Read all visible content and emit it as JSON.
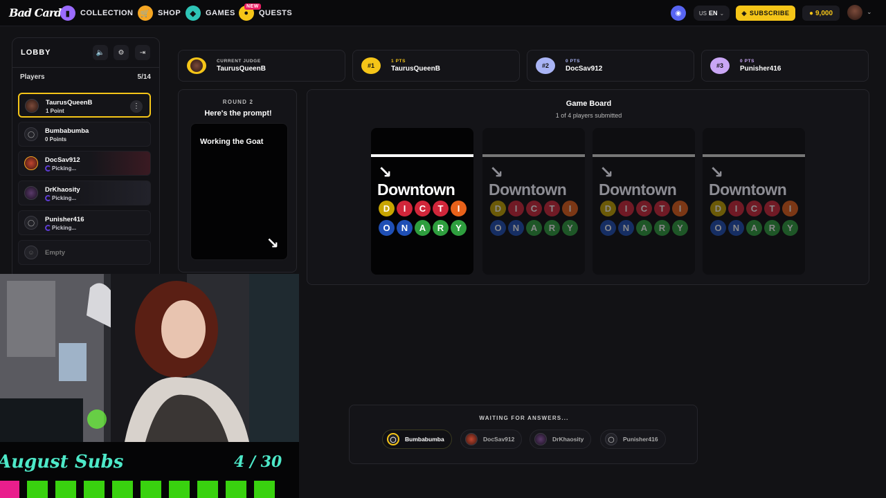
{
  "brand": {
    "logo": "Bad Cards"
  },
  "nav": {
    "items": [
      {
        "label": "COLLECTION",
        "icon": "card-icon",
        "color": "#9b6bff"
      },
      {
        "label": "SHOP",
        "icon": "cart-icon",
        "color": "#f5a623"
      },
      {
        "label": "GAMES",
        "icon": "gamepad-icon",
        "color": "#2ec4b6"
      },
      {
        "label": "QUESTS",
        "icon": "quest-icon",
        "color": "#f5c518",
        "badge": "NEW"
      }
    ],
    "lang_region": "US",
    "lang_code": "EN",
    "subscribe_label": "SUBSCRIBE",
    "coins": "9,000"
  },
  "lobby": {
    "title": "LOBBY",
    "players_label": "Players",
    "players_count": "5/14",
    "players": [
      {
        "name": "TaurusQueenB",
        "status": "1 Point",
        "active": true
      },
      {
        "name": "Bumbabumba",
        "status": "0 Points"
      },
      {
        "name": "DocSav912",
        "status": "Picking..."
      },
      {
        "name": "DrKhaosity",
        "status": "Picking..."
      },
      {
        "name": "Punisher416",
        "status": "Picking..."
      },
      {
        "name": "Empty",
        "status": ""
      }
    ]
  },
  "scoreboard": [
    {
      "label": "CURRENT JUDGE",
      "name": "TaurusQueenB",
      "badge": "",
      "color": "#f5c518"
    },
    {
      "label": "1 PTS",
      "name": "TaurusQueenB",
      "badge": "#1",
      "color": "#f5c518"
    },
    {
      "label": "0 PTS",
      "name": "DocSav912",
      "badge": "#2",
      "color": "#a9b4f5"
    },
    {
      "label": "0 PTS",
      "name": "Punisher416",
      "badge": "#3",
      "color": "#c9a6f5"
    }
  ],
  "prompt": {
    "round": "ROUND 2",
    "heading": "Here's the prompt!",
    "text": "Working the Goat"
  },
  "board": {
    "title": "Game Board",
    "subtitle": "1 of 4 players submitted",
    "card_word": "Downtown",
    "row1": [
      "D",
      "I",
      "C",
      "T",
      "I"
    ],
    "row2": [
      "O",
      "N",
      "A",
      "R",
      "Y"
    ],
    "row1_colors": [
      "#c8a500",
      "#d1263a",
      "#d1263a",
      "#d1263a",
      "#e8611a"
    ],
    "row2_colors": [
      "#1f4fb5",
      "#1f4fb5",
      "#2e9e3e",
      "#2e9e3e",
      "#2e9e3e"
    ]
  },
  "waiting": {
    "label": "WAITING FOR ANSWERS...",
    "players": [
      "Bumbabumba",
      "DocSav912",
      "DrKhaosity",
      "Punisher416"
    ]
  },
  "overlay": {
    "goal_title": "August Subs",
    "goal_count": "4 / 30",
    "bar_colors": [
      "#e91e8c",
      "#39d20f",
      "#39d20f",
      "#39d20f",
      "#39d20f",
      "#39d20f",
      "#39d20f",
      "#39d20f",
      "#39d20f",
      "#39d20f"
    ]
  }
}
